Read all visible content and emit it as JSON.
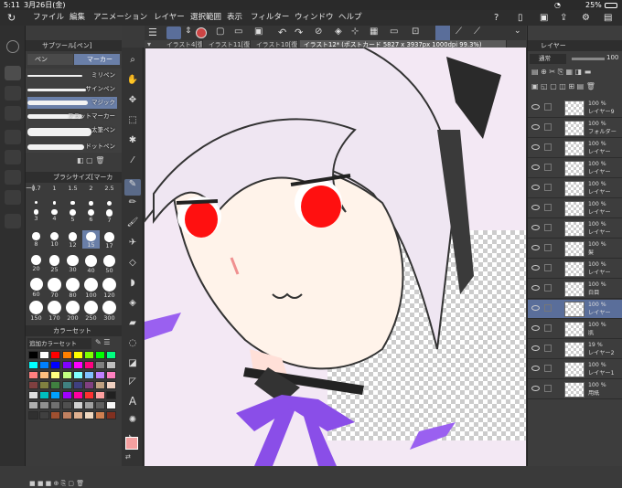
{
  "status": {
    "time": "5:11",
    "date": "3月26日(金)",
    "battery": "25%"
  },
  "menu": [
    "ファイル",
    "編集",
    "アニメーション",
    "レイヤー",
    "選択範囲",
    "表示",
    "フィルター",
    "ウィンドウ",
    "ヘルプ"
  ],
  "tabs": [
    {
      "label": "イラスト4[復元]"
    },
    {
      "label": "イラスト11[復元]"
    },
    {
      "label": "イラスト10[復元]"
    },
    {
      "label": "イラスト12* (ポストカード 5827 x 3937px 1000dpi 99.3%)"
    }
  ],
  "subtool": {
    "header": "サブツール[ペン]",
    "tab_pen": "ペン",
    "tab_marker": "マーカー",
    "brushes": [
      "ミリペン",
      "サインペン",
      "マジック",
      "フラットマーカー",
      "太筆ペン",
      "ドットペン"
    ]
  },
  "brushsize": {
    "header": "ブラシサイズ[マーカー]",
    "sizes": [
      "0.7",
      "1",
      "1.5",
      "2",
      "2.5",
      "3",
      "4",
      "5",
      "6",
      "7",
      "8",
      "10",
      "12",
      "15",
      "17",
      "20",
      "25",
      "30",
      "40",
      "50",
      "60",
      "70",
      "80",
      "100",
      "120",
      "150",
      "170",
      "200",
      "250",
      "300"
    ],
    "selected": "15"
  },
  "colorset": {
    "header": "カラーセット",
    "set_name": "追加カラーセット",
    "colors": [
      "#000000",
      "#ffffff",
      "#ff0000",
      "#ff8000",
      "#ffff00",
      "#80ff00",
      "#00ff00",
      "#00ff80",
      "#00ffff",
      "#0080ff",
      "#0000ff",
      "#8000ff",
      "#ff00ff",
      "#ff0080",
      "#808080",
      "#c0c0c0",
      "#ff8080",
      "#ffc080",
      "#ffff80",
      "#c0ff80",
      "#80ffff",
      "#80c0ff",
      "#c080ff",
      "#ff80c0",
      "#804040",
      "#808040",
      "#408040",
      "#408080",
      "#404080",
      "#804080",
      "#c0a080",
      "#f0d0c0",
      "#e0e0e0",
      "#00c0c0",
      "#00a0ff",
      "#a000ff",
      "#ff00a0",
      "#ff3030",
      "#ffa0a0",
      "#202020",
      "#b0b0b0",
      "#909090",
      "#707070",
      "#505050",
      "#d0d0d0",
      "#a0a0a0",
      "#606060",
      "#f8f8f8",
      "#303030",
      "#404040",
      "#a05030",
      "#c08060",
      "#e0b090",
      "#f0d8c0",
      "#d08050",
      "#803020"
    ]
  },
  "layers": [
    {
      "pct": "100 %",
      "name": "レイヤー9"
    },
    {
      "pct": "100 %",
      "name": "フォルダー"
    },
    {
      "pct": "100 %",
      "name": "レイヤー"
    },
    {
      "pct": "100 %",
      "name": "レイヤー"
    },
    {
      "pct": "100 %",
      "name": "レイヤー"
    },
    {
      "pct": "100 %",
      "name": "レイヤー"
    },
    {
      "pct": "100 %",
      "name": "レイヤー"
    },
    {
      "pct": "100 %",
      "name": "髪"
    },
    {
      "pct": "100 %",
      "name": "レイヤー"
    },
    {
      "pct": "100 %",
      "name": "白目"
    },
    {
      "pct": "100 %",
      "name": "レイヤー"
    },
    {
      "pct": "100 %",
      "name": "肌"
    },
    {
      "pct": "19 %",
      "name": "レイヤー2"
    },
    {
      "pct": "100 %",
      "name": "レイヤー1"
    },
    {
      "pct": "100 %",
      "name": "用紙"
    }
  ],
  "layer_header": "レイヤー",
  "opacity_value": "100",
  "blend_mode": "通常",
  "colors": {
    "accent": "#5a6e9a",
    "main_color": "#f4a0a0"
  }
}
